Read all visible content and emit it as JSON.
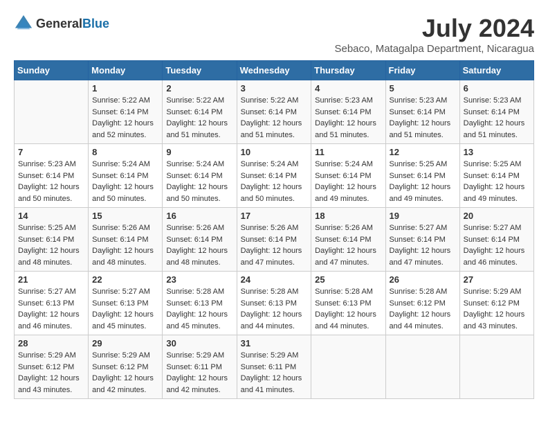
{
  "header": {
    "logo_general": "General",
    "logo_blue": "Blue",
    "month_year": "July 2024",
    "location": "Sebaco, Matagalpa Department, Nicaragua"
  },
  "days_of_week": [
    "Sunday",
    "Monday",
    "Tuesday",
    "Wednesday",
    "Thursday",
    "Friday",
    "Saturday"
  ],
  "weeks": [
    [
      {
        "day": "",
        "sunrise": "",
        "sunset": "",
        "daylight": ""
      },
      {
        "day": "1",
        "sunrise": "Sunrise: 5:22 AM",
        "sunset": "Sunset: 6:14 PM",
        "daylight": "Daylight: 12 hours and 52 minutes."
      },
      {
        "day": "2",
        "sunrise": "Sunrise: 5:22 AM",
        "sunset": "Sunset: 6:14 PM",
        "daylight": "Daylight: 12 hours and 51 minutes."
      },
      {
        "day": "3",
        "sunrise": "Sunrise: 5:22 AM",
        "sunset": "Sunset: 6:14 PM",
        "daylight": "Daylight: 12 hours and 51 minutes."
      },
      {
        "day": "4",
        "sunrise": "Sunrise: 5:23 AM",
        "sunset": "Sunset: 6:14 PM",
        "daylight": "Daylight: 12 hours and 51 minutes."
      },
      {
        "day": "5",
        "sunrise": "Sunrise: 5:23 AM",
        "sunset": "Sunset: 6:14 PM",
        "daylight": "Daylight: 12 hours and 51 minutes."
      },
      {
        "day": "6",
        "sunrise": "Sunrise: 5:23 AM",
        "sunset": "Sunset: 6:14 PM",
        "daylight": "Daylight: 12 hours and 51 minutes."
      }
    ],
    [
      {
        "day": "7",
        "sunrise": "Sunrise: 5:23 AM",
        "sunset": "Sunset: 6:14 PM",
        "daylight": "Daylight: 12 hours and 50 minutes."
      },
      {
        "day": "8",
        "sunrise": "Sunrise: 5:24 AM",
        "sunset": "Sunset: 6:14 PM",
        "daylight": "Daylight: 12 hours and 50 minutes."
      },
      {
        "day": "9",
        "sunrise": "Sunrise: 5:24 AM",
        "sunset": "Sunset: 6:14 PM",
        "daylight": "Daylight: 12 hours and 50 minutes."
      },
      {
        "day": "10",
        "sunrise": "Sunrise: 5:24 AM",
        "sunset": "Sunset: 6:14 PM",
        "daylight": "Daylight: 12 hours and 50 minutes."
      },
      {
        "day": "11",
        "sunrise": "Sunrise: 5:24 AM",
        "sunset": "Sunset: 6:14 PM",
        "daylight": "Daylight: 12 hours and 49 minutes."
      },
      {
        "day": "12",
        "sunrise": "Sunrise: 5:25 AM",
        "sunset": "Sunset: 6:14 PM",
        "daylight": "Daylight: 12 hours and 49 minutes."
      },
      {
        "day": "13",
        "sunrise": "Sunrise: 5:25 AM",
        "sunset": "Sunset: 6:14 PM",
        "daylight": "Daylight: 12 hours and 49 minutes."
      }
    ],
    [
      {
        "day": "14",
        "sunrise": "Sunrise: 5:25 AM",
        "sunset": "Sunset: 6:14 PM",
        "daylight": "Daylight: 12 hours and 48 minutes."
      },
      {
        "day": "15",
        "sunrise": "Sunrise: 5:26 AM",
        "sunset": "Sunset: 6:14 PM",
        "daylight": "Daylight: 12 hours and 48 minutes."
      },
      {
        "day": "16",
        "sunrise": "Sunrise: 5:26 AM",
        "sunset": "Sunset: 6:14 PM",
        "daylight": "Daylight: 12 hours and 48 minutes."
      },
      {
        "day": "17",
        "sunrise": "Sunrise: 5:26 AM",
        "sunset": "Sunset: 6:14 PM",
        "daylight": "Daylight: 12 hours and 47 minutes."
      },
      {
        "day": "18",
        "sunrise": "Sunrise: 5:26 AM",
        "sunset": "Sunset: 6:14 PM",
        "daylight": "Daylight: 12 hours and 47 minutes."
      },
      {
        "day": "19",
        "sunrise": "Sunrise: 5:27 AM",
        "sunset": "Sunset: 6:14 PM",
        "daylight": "Daylight: 12 hours and 47 minutes."
      },
      {
        "day": "20",
        "sunrise": "Sunrise: 5:27 AM",
        "sunset": "Sunset: 6:14 PM",
        "daylight": "Daylight: 12 hours and 46 minutes."
      }
    ],
    [
      {
        "day": "21",
        "sunrise": "Sunrise: 5:27 AM",
        "sunset": "Sunset: 6:13 PM",
        "daylight": "Daylight: 12 hours and 46 minutes."
      },
      {
        "day": "22",
        "sunrise": "Sunrise: 5:27 AM",
        "sunset": "Sunset: 6:13 PM",
        "daylight": "Daylight: 12 hours and 45 minutes."
      },
      {
        "day": "23",
        "sunrise": "Sunrise: 5:28 AM",
        "sunset": "Sunset: 6:13 PM",
        "daylight": "Daylight: 12 hours and 45 minutes."
      },
      {
        "day": "24",
        "sunrise": "Sunrise: 5:28 AM",
        "sunset": "Sunset: 6:13 PM",
        "daylight": "Daylight: 12 hours and 44 minutes."
      },
      {
        "day": "25",
        "sunrise": "Sunrise: 5:28 AM",
        "sunset": "Sunset: 6:13 PM",
        "daylight": "Daylight: 12 hours and 44 minutes."
      },
      {
        "day": "26",
        "sunrise": "Sunrise: 5:28 AM",
        "sunset": "Sunset: 6:12 PM",
        "daylight": "Daylight: 12 hours and 44 minutes."
      },
      {
        "day": "27",
        "sunrise": "Sunrise: 5:29 AM",
        "sunset": "Sunset: 6:12 PM",
        "daylight": "Daylight: 12 hours and 43 minutes."
      }
    ],
    [
      {
        "day": "28",
        "sunrise": "Sunrise: 5:29 AM",
        "sunset": "Sunset: 6:12 PM",
        "daylight": "Daylight: 12 hours and 43 minutes."
      },
      {
        "day": "29",
        "sunrise": "Sunrise: 5:29 AM",
        "sunset": "Sunset: 6:12 PM",
        "daylight": "Daylight: 12 hours and 42 minutes."
      },
      {
        "day": "30",
        "sunrise": "Sunrise: 5:29 AM",
        "sunset": "Sunset: 6:11 PM",
        "daylight": "Daylight: 12 hours and 42 minutes."
      },
      {
        "day": "31",
        "sunrise": "Sunrise: 5:29 AM",
        "sunset": "Sunset: 6:11 PM",
        "daylight": "Daylight: 12 hours and 41 minutes."
      },
      {
        "day": "",
        "sunrise": "",
        "sunset": "",
        "daylight": ""
      },
      {
        "day": "",
        "sunrise": "",
        "sunset": "",
        "daylight": ""
      },
      {
        "day": "",
        "sunrise": "",
        "sunset": "",
        "daylight": ""
      }
    ]
  ]
}
